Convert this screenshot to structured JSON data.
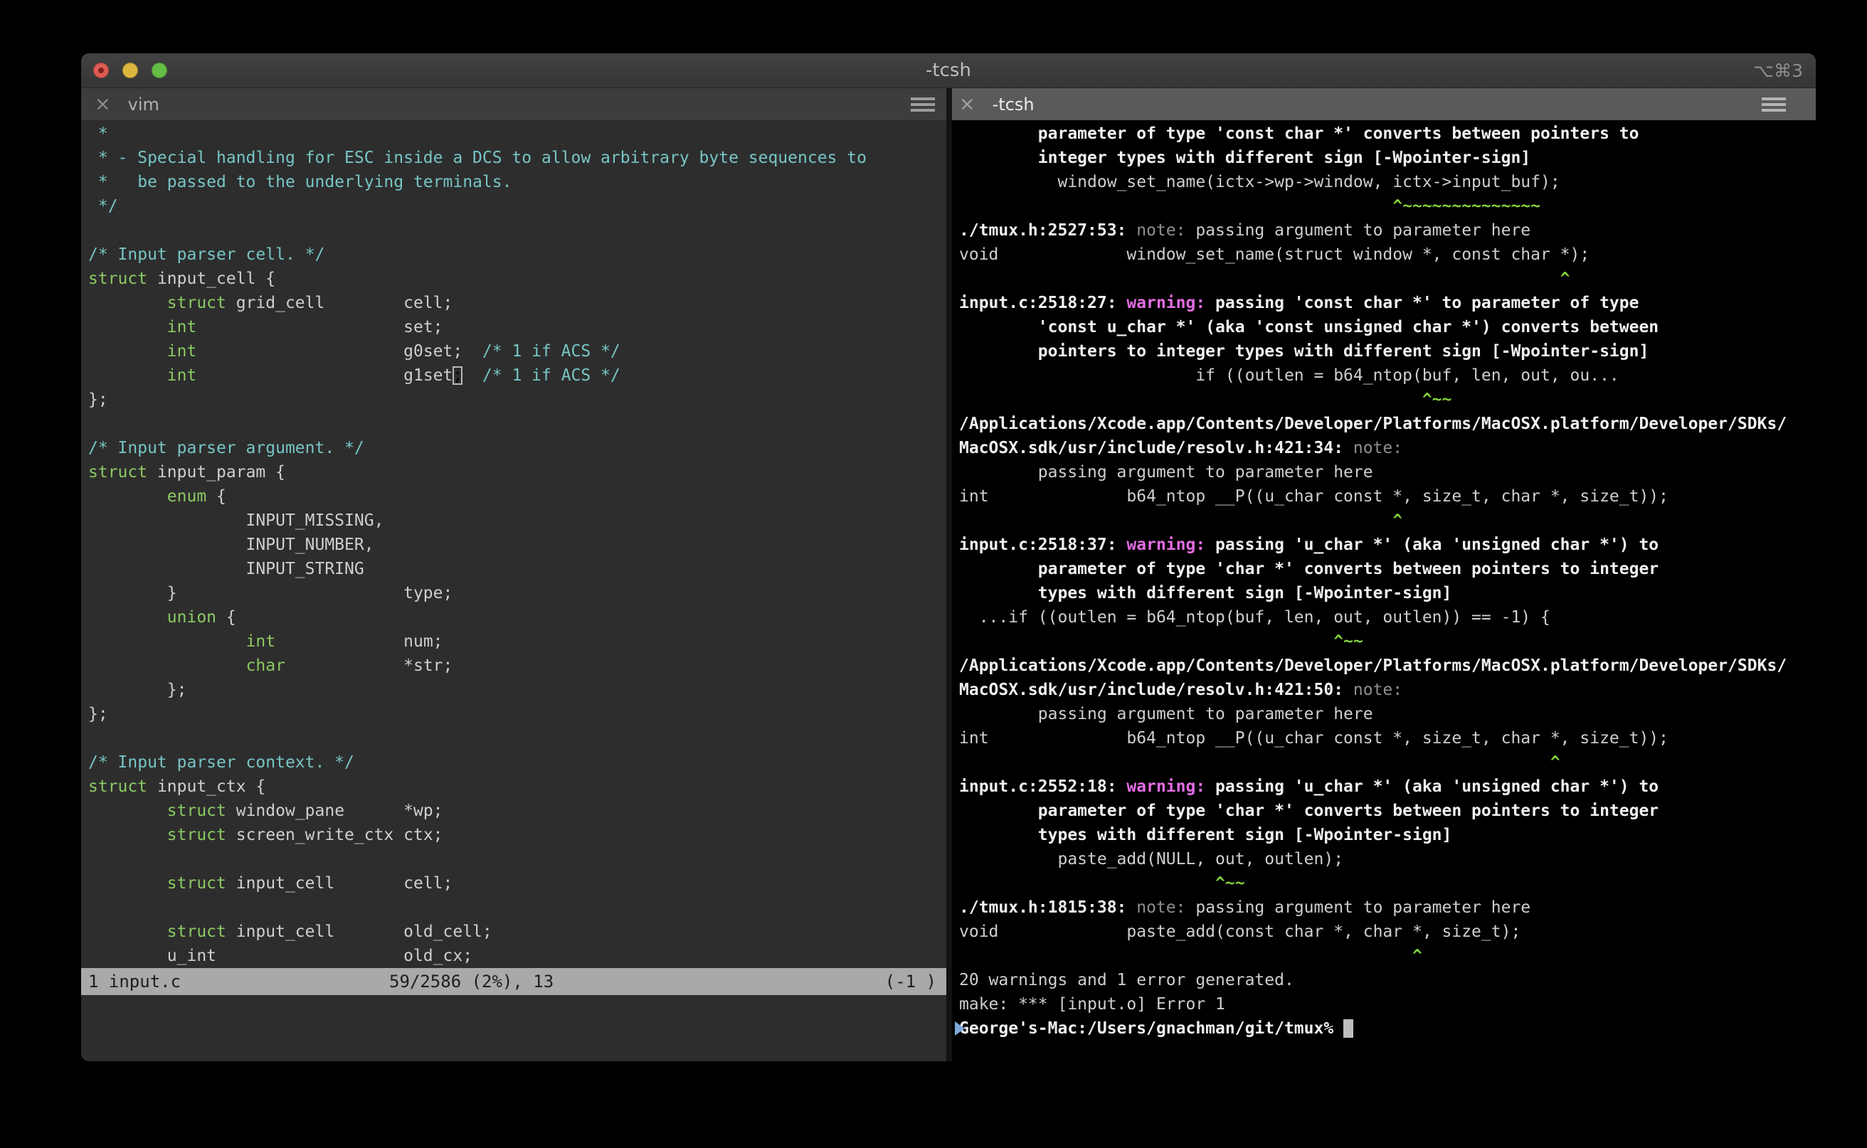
{
  "window": {
    "title": "-tcsh",
    "shortcut": "⌥⌘3"
  },
  "tabs": {
    "left": {
      "close": "×",
      "label": "vim"
    },
    "right": {
      "close": "×",
      "label": "-tcsh"
    }
  },
  "vim": {
    "lines": [
      [
        [
          "c",
          " *"
        ]
      ],
      [
        [
          "c",
          " * - Special handling for ESC inside a DCS to allow arbitrary byte sequences to"
        ]
      ],
      [
        [
          "c",
          " *   be passed to the underlying terminals."
        ]
      ],
      [
        [
          "c",
          " */"
        ]
      ],
      [],
      [
        [
          "c",
          "/* Input parser cell. */"
        ]
      ],
      [
        [
          "k",
          "struct"
        ],
        [
          "p",
          " input_cell {"
        ]
      ],
      [
        [
          "p",
          "        "
        ],
        [
          "k",
          "struct"
        ],
        [
          "p",
          " grid_cell        cell;"
        ]
      ],
      [
        [
          "p",
          "        "
        ],
        [
          "k",
          "int"
        ],
        [
          "p",
          "                     set;"
        ]
      ],
      [
        [
          "p",
          "        "
        ],
        [
          "k",
          "int"
        ],
        [
          "p",
          "                     g0set;  "
        ],
        [
          "c",
          "/* 1 if ACS */"
        ]
      ],
      [
        [
          "p",
          "        "
        ],
        [
          "k",
          "int"
        ],
        [
          "p",
          "                     g1set"
        ],
        [
          "cu",
          ";"
        ],
        [
          "p",
          "  "
        ],
        [
          "c",
          "/* 1 if ACS */"
        ]
      ],
      [
        [
          "p",
          "};"
        ]
      ],
      [],
      [
        [
          "c",
          "/* Input parser argument. */"
        ]
      ],
      [
        [
          "k",
          "struct"
        ],
        [
          "p",
          " input_param {"
        ]
      ],
      [
        [
          "p",
          "        "
        ],
        [
          "k",
          "enum"
        ],
        [
          "p",
          " {"
        ]
      ],
      [
        [
          "p",
          "                INPUT_MISSING,"
        ]
      ],
      [
        [
          "p",
          "                INPUT_NUMBER,"
        ]
      ],
      [
        [
          "p",
          "                INPUT_STRING"
        ]
      ],
      [
        [
          "p",
          "        }                       type;"
        ]
      ],
      [
        [
          "p",
          "        "
        ],
        [
          "k",
          "union"
        ],
        [
          "p",
          " {"
        ]
      ],
      [
        [
          "p",
          "                "
        ],
        [
          "k",
          "int"
        ],
        [
          "p",
          "             num;"
        ]
      ],
      [
        [
          "p",
          "                "
        ],
        [
          "k",
          "char"
        ],
        [
          "p",
          "            *str;"
        ]
      ],
      [
        [
          "p",
          "        };"
        ]
      ],
      [
        [
          "p",
          "};"
        ]
      ],
      [],
      [
        [
          "c",
          "/* Input parser context. */"
        ]
      ],
      [
        [
          "k",
          "struct"
        ],
        [
          "p",
          " input_ctx {"
        ]
      ],
      [
        [
          "p",
          "        "
        ],
        [
          "k",
          "struct"
        ],
        [
          "p",
          " window_pane      *wp;"
        ]
      ],
      [
        [
          "p",
          "        "
        ],
        [
          "k",
          "struct"
        ],
        [
          "p",
          " screen_write_ctx ctx;"
        ]
      ],
      [],
      [
        [
          "p",
          "        "
        ],
        [
          "k",
          "struct"
        ],
        [
          "p",
          " input_cell       cell;"
        ]
      ],
      [],
      [
        [
          "p",
          "        "
        ],
        [
          "k",
          "struct"
        ],
        [
          "p",
          " input_cell       old_cell;"
        ]
      ],
      [
        [
          "p",
          "        u_int                   old_cx;"
        ]
      ]
    ],
    "status": {
      "left": "1 input.c",
      "center": "59/2586 (2%), 13",
      "right": "(-1 )"
    }
  },
  "terminal": {
    "lines": [
      [
        [
          "b",
          "        parameter of type 'const char *' converts between pointers to"
        ]
      ],
      [
        [
          "b",
          "        integer types with different sign [-Wpointer-sign]"
        ]
      ],
      [
        [
          "r",
          "          window_set_name(ictx->wp->window, ictx->input_buf);"
        ]
      ],
      [
        [
          "g",
          "^~~~~~~~~~~~~~~",
          44
        ]
      ],
      [
        [
          "b",
          "./tmux.h:2527:53: "
        ],
        [
          "d",
          "note: "
        ],
        [
          "r",
          "passing argument to parameter here"
        ]
      ],
      [
        [
          "r",
          "void             window_set_name(struct window *, const char *);"
        ]
      ],
      [
        [
          "g",
          "^",
          61
        ]
      ],
      [
        [
          "b",
          "input.c:2518:27: "
        ],
        [
          "m",
          "warning: "
        ],
        [
          "b",
          "passing 'const char *' to parameter of type"
        ]
      ],
      [
        [
          "b",
          "        'const u_char *' (aka 'const unsigned char *') converts between"
        ]
      ],
      [
        [
          "b",
          "        pointers to integer types with different sign [-Wpointer-sign]"
        ]
      ],
      [
        [
          "r",
          "                        if ((outlen = b64_ntop(buf, len, out, ou..."
        ]
      ],
      [
        [
          "g",
          "^~~",
          47
        ]
      ],
      [
        [
          "b",
          "/Applications/Xcode.app/Contents/Developer/Platforms/MacOSX.platform/Developer/SDKs/"
        ]
      ],
      [
        [
          "b",
          "MacOSX.sdk/usr/include/resolv.h:421:34: "
        ],
        [
          "d",
          "note:"
        ]
      ],
      [
        [
          "r",
          "        passing argument to parameter here"
        ]
      ],
      [
        [
          "r",
          "int              b64_ntop __P((u_char const *, size_t, char *, size_t));"
        ]
      ],
      [
        [
          "g",
          "^",
          44
        ]
      ],
      [
        [
          "b",
          "input.c:2518:37: "
        ],
        [
          "m",
          "warning: "
        ],
        [
          "b",
          "passing 'u_char *' (aka 'unsigned char *') to"
        ]
      ],
      [
        [
          "b",
          "        parameter of type 'char *' converts between pointers to integer"
        ]
      ],
      [
        [
          "b",
          "        types with different sign [-Wpointer-sign]"
        ]
      ],
      [
        [
          "r",
          "  ...if ((outlen = b64_ntop(buf, len, out, outlen)) == -1) {"
        ]
      ],
      [
        [
          "g",
          "^~~",
          38
        ]
      ],
      [
        [
          "b",
          "/Applications/Xcode.app/Contents/Developer/Platforms/MacOSX.platform/Developer/SDKs/"
        ]
      ],
      [
        [
          "b",
          "MacOSX.sdk/usr/include/resolv.h:421:50: "
        ],
        [
          "d",
          "note:"
        ]
      ],
      [
        [
          "r",
          "        passing argument to parameter here"
        ]
      ],
      [
        [
          "r",
          "int              b64_ntop __P((u_char const *, size_t, char *, size_t));"
        ]
      ],
      [
        [
          "g",
          "^",
          60
        ]
      ],
      [
        [
          "b",
          "input.c:2552:18: "
        ],
        [
          "m",
          "warning: "
        ],
        [
          "b",
          "passing 'u_char *' (aka 'unsigned char *') to"
        ]
      ],
      [
        [
          "b",
          "        parameter of type 'char *' converts between pointers to integer"
        ]
      ],
      [
        [
          "b",
          "        types with different sign [-Wpointer-sign]"
        ]
      ],
      [
        [
          "r",
          "          paste_add(NULL, out, outlen);"
        ]
      ],
      [
        [
          "g",
          "^~~",
          26
        ]
      ],
      [
        [
          "b",
          "./tmux.h:1815:38: "
        ],
        [
          "d",
          "note: "
        ],
        [
          "r",
          "passing argument to parameter here"
        ]
      ],
      [
        [
          "r",
          "void             paste_add(const char *, char *, size_t);"
        ]
      ],
      [
        [
          "g",
          "^",
          46
        ]
      ],
      [
        [
          "r",
          "20 warnings and 1 error generated."
        ]
      ],
      [
        [
          "r",
          "make: *** [input.o] Error 1"
        ]
      ],
      [
        [
          "mki",
          "triangle-right"
        ],
        [
          "b",
          "George's-Mac:/Users/gnachman/git/tmux% "
        ],
        [
          "cb",
          " "
        ]
      ]
    ],
    "prompt_mark_icon": "triangle-right"
  },
  "colors": {
    "vim_comment": "#78c5c5",
    "vim_keyword": "#8cc963",
    "warning_magenta": "#e36ce3",
    "caret_green": "#83d33c",
    "note_gray": "#8f8f8f",
    "prompt_mark_blue": "#7ea7dc",
    "status_bar_bg": "#a9a9a9"
  }
}
